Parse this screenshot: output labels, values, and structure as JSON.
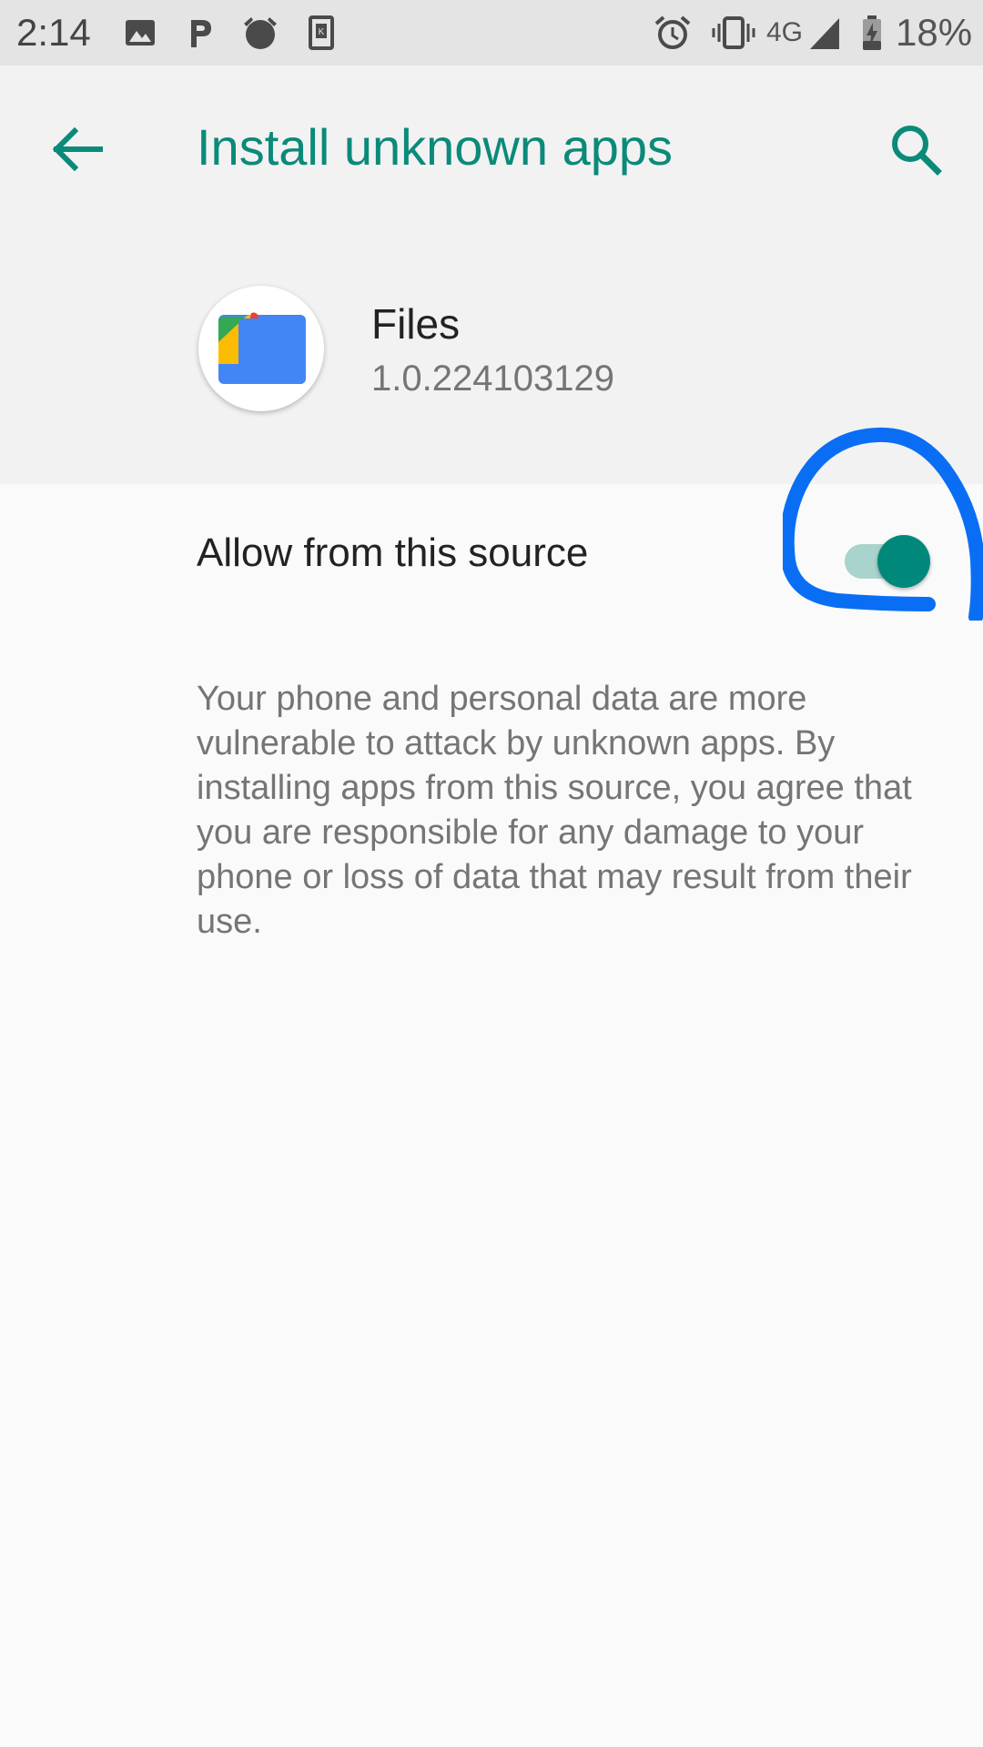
{
  "status_bar": {
    "time": "2:14",
    "icons_left": [
      "image-icon",
      "parking-icon",
      "alarm-clock-notification-icon",
      "k-app-icon"
    ],
    "icons_right": [
      "alarm-icon",
      "vibrate-icon",
      "signal-icon",
      "battery-charging-icon"
    ],
    "network": "4G",
    "battery": "18%"
  },
  "toolbar": {
    "title": "Install unknown apps",
    "back_icon": "arrow-back-icon",
    "search_icon": "search-icon"
  },
  "app": {
    "name": "Files",
    "version": "1.0.224103129",
    "icon": "files-app-icon"
  },
  "allow_setting": {
    "label": "Allow from this source",
    "enabled": true
  },
  "warning": {
    "text": "Your phone and personal data are more vulnerable to attack by unknown apps. By installing apps from this source, you agree that you are responsible for any damage to your phone or loss of data that may result from their use."
  },
  "colors": {
    "accent": "#00897b",
    "title": "#0b8a79",
    "annotation": "#0a6ef5"
  }
}
